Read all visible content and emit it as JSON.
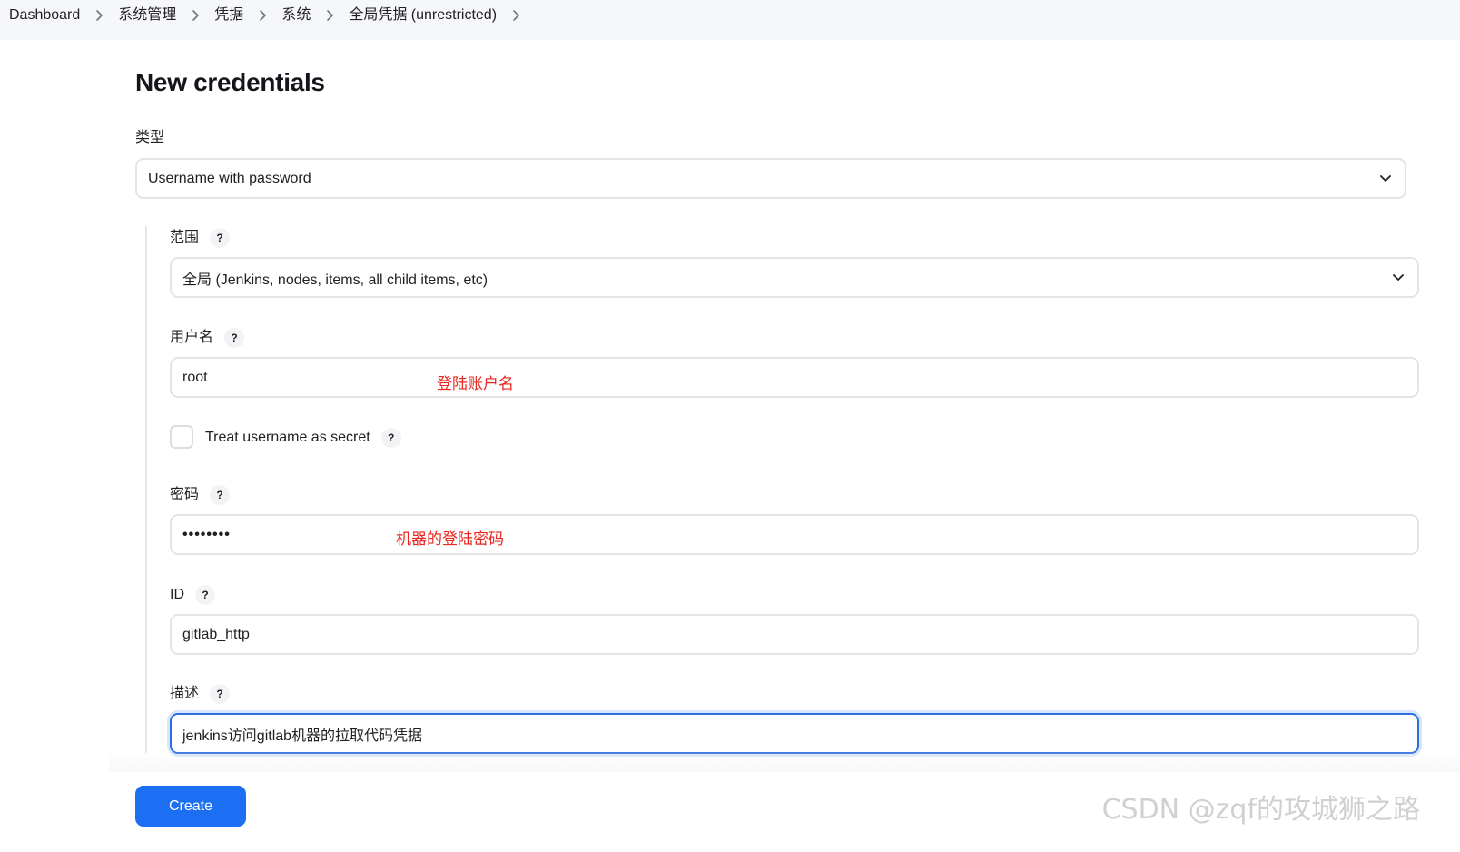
{
  "breadcrumb": {
    "items": [
      "Dashboard",
      "系统管理",
      "凭据",
      "系统",
      "全局凭据 (unrestricted)"
    ]
  },
  "page": {
    "title": "New credentials"
  },
  "type_field": {
    "label": "类型",
    "selected": "Username with password"
  },
  "scope_field": {
    "label": "范围",
    "selected": "全局 (Jenkins, nodes, items, all child items, etc)"
  },
  "username_field": {
    "label": "用户名",
    "value": "root",
    "annotation": "登陆账户名"
  },
  "secret_checkbox": {
    "label": "Treat username as secret",
    "checked": false
  },
  "password_field": {
    "label": "密码",
    "value": "••••••••",
    "annotation": "机器的登陆密码"
  },
  "id_field": {
    "label": "ID",
    "value": "gitlab_http"
  },
  "description_field": {
    "label": "描述",
    "value": "jenkins访问gitlab机器的拉取代码凭据"
  },
  "help": {
    "glyph": "?"
  },
  "actions": {
    "create_label": "Create"
  },
  "watermark": {
    "text": "CSDN @zqf的攻城狮之路"
  },
  "colors": {
    "accent": "#1c6ff2",
    "annotation": "#e8261f",
    "focus_border": "#2d6fe0"
  }
}
